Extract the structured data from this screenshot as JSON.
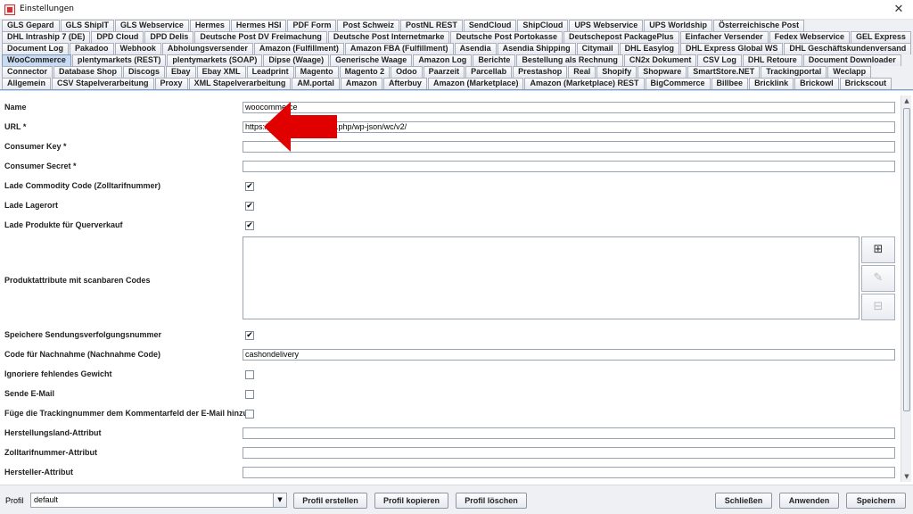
{
  "window": {
    "title": "Einstellungen",
    "close_symbol": "✕"
  },
  "tabs": {
    "rows": [
      [
        "GLS Gepard",
        "GLS ShipIT",
        "GLS Webservice",
        "Hermes",
        "Hermes HSI",
        "PDF Form",
        "Post Schweiz",
        "PostNL REST",
        "SendCloud",
        "ShipCloud",
        "UPS Webservice",
        "UPS Worldship",
        "Österreichische Post"
      ],
      [
        "DHL Intraship 7 (DE)",
        "DPD Cloud",
        "DPD Delis",
        "Deutsche Post DV Freimachung",
        "Deutsche Post Internetmarke",
        "Deutsche Post Portokasse",
        "Deutschepost PackagePlus",
        "Einfacher Versender",
        "Fedex Webservice",
        "GEL Express"
      ],
      [
        "Document Log",
        "Pakadoo",
        "Webhook",
        "Abholungsversender",
        "Amazon (Fulfillment)",
        "Amazon FBA (Fulfillment)",
        "Asendia",
        "Asendia Shipping",
        "Citymail",
        "DHL Easylog",
        "DHL Express Global WS",
        "DHL Geschäftskundenversand"
      ],
      [
        "WooCommerce",
        "plentymarkets (REST)",
        "plentymarkets (SOAP)",
        "Dipse (Waage)",
        "Generische Waage",
        "Amazon Log",
        "Berichte",
        "Bestellung als Rechnung",
        "CN2x Dokument",
        "CSV Log",
        "DHL Retoure",
        "Document Downloader"
      ],
      [
        "Connector",
        "Database Shop",
        "Discogs",
        "Ebay",
        "Ebay XML",
        "Leadprint",
        "Magento",
        "Magento 2",
        "Odoo",
        "Paarzeit",
        "Parcellab",
        "Prestashop",
        "Real",
        "Shopify",
        "Shopware",
        "SmartStore.NET",
        "Trackingportal",
        "Weclapp"
      ],
      [
        "Allgemein",
        "CSV Stapelverarbeitung",
        "Proxy",
        "XML Stapelverarbeitung",
        "AM.portal",
        "Amazon",
        "Afterbuy",
        "Amazon (Marketplace)",
        "Amazon (Marketplace) REST",
        "BigCommerce",
        "Billbee",
        "Bricklink",
        "Brickowl",
        "Brickscout"
      ]
    ],
    "active": "WooCommerce"
  },
  "form": {
    "name": {
      "label": "Name",
      "value": "woocommerce"
    },
    "url": {
      "label": "URL *",
      "value": "https://<w                         .ce.com>/index.php/wp-json/wc/v2/"
    },
    "consumer_key": {
      "label": "Consumer Key *",
      "value": ""
    },
    "consumer_secret": {
      "label": "Consumer Secret *",
      "value": ""
    },
    "lade_commodity": {
      "label": "Lade Commodity Code (Zolltarifnummer)",
      "check": "✔"
    },
    "lade_lagerort": {
      "label": "Lade Lagerort",
      "check": "✔"
    },
    "lade_produkte": {
      "label": "Lade Produkte für Querverkauf",
      "check": "✔"
    },
    "produktattribute": {
      "label": "Produktattribute mit scanbaren Codes"
    },
    "speichere": {
      "label": "Speichere Sendungsverfolgungsnummer",
      "check": "✔"
    },
    "code_nachnahme": {
      "label": "Code für Nachnahme (Nachnahme Code)",
      "value": "cashondelivery"
    },
    "ignoriere": {
      "label": "Ignoriere fehlendes Gewicht",
      "check": ""
    },
    "sende_email": {
      "label": "Sende E-Mail",
      "check": ""
    },
    "fuege_tracking": {
      "label": "Füge die Trackingnummer dem Kommentarfeld der E-Mail hinzu",
      "check": ""
    },
    "herstellungsland": {
      "label": "Herstellungsland-Attribut",
      "value": ""
    },
    "zolltarifnummer": {
      "label": "Zolltarifnummer-Attribut",
      "value": ""
    },
    "hersteller": {
      "label": "Hersteller-Attribut",
      "value": ""
    }
  },
  "side_buttons": {
    "add": "⊞",
    "edit": "✎",
    "remove": "⊟"
  },
  "colors": {
    "arrow": "#e00000",
    "active_tab": "#c9dbf2"
  },
  "bottom": {
    "profil_label": "Profil",
    "profil_value": "default",
    "arrow": "▼",
    "profil_erstellen": "Profil erstellen",
    "profil_kopieren": "Profil kopieren",
    "profil_loeschen": "Profil löschen",
    "schliessen": "Schließen",
    "anwenden": "Anwenden",
    "speichern": "Speichern"
  },
  "scrollbar": {
    "up": "▲",
    "down": "▼"
  }
}
